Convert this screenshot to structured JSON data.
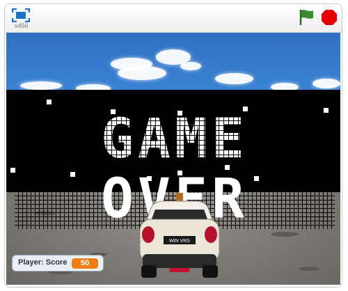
{
  "player": {
    "version": "v456",
    "flag_color": "#3a8a2e",
    "stop_color": "#e40000"
  },
  "stage": {
    "banner_text": "GAME OVER",
    "car_plate": "WIN VRS"
  },
  "monitor": {
    "label": "Player: Score",
    "value": "50",
    "value_color": "#ee7d16"
  },
  "icons": {
    "fullscreen": "fullscreen-icon",
    "green_flag": "green-flag-icon",
    "stop": "stop-icon"
  }
}
